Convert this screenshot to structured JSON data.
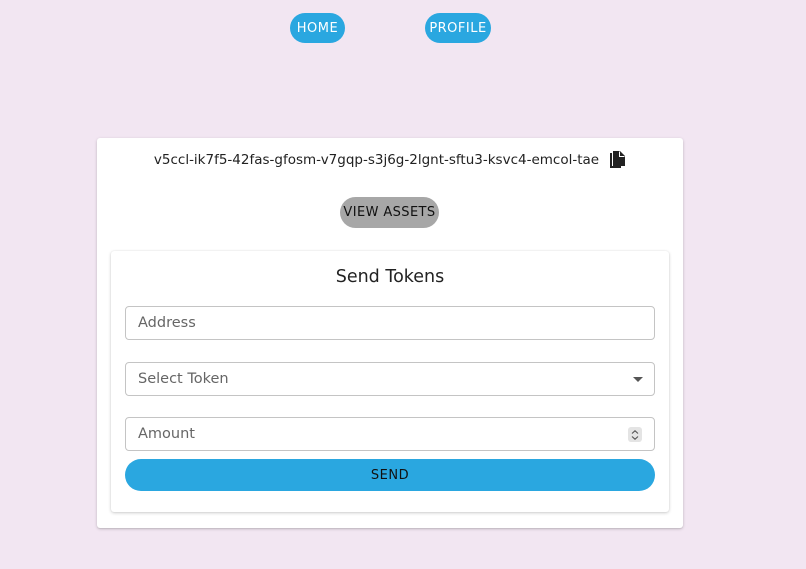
{
  "nav": {
    "home_label": "HOME",
    "profile_label": "PROFILE"
  },
  "wallet": {
    "principal": "v5ccl-ik7f5-42fas-gfosm-v7gqp-s3j6g-2lgnt-sftu3-ksvc4-emcol-tae",
    "copy_icon": "copy-icon",
    "view_assets_label": "VIEW ASSETS"
  },
  "send_form": {
    "title": "Send Tokens",
    "address_placeholder": "Address",
    "token_placeholder": "Select Token",
    "amount_placeholder": "Amount",
    "send_label": "SEND"
  },
  "colors": {
    "background": "#f2e6f2",
    "primary": "#2aa7e0",
    "secondary_button": "#a7a7a7"
  }
}
